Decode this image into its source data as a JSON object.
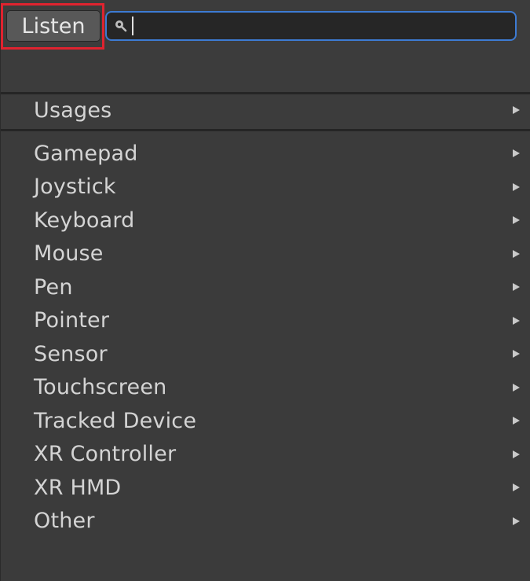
{
  "toolbar": {
    "listen_label": "Listen",
    "search_value": "",
    "search_placeholder": ""
  },
  "usages": {
    "label": "Usages"
  },
  "devices": [
    {
      "label": "Gamepad"
    },
    {
      "label": "Joystick"
    },
    {
      "label": "Keyboard"
    },
    {
      "label": "Mouse"
    },
    {
      "label": "Pen"
    },
    {
      "label": "Pointer"
    },
    {
      "label": "Sensor"
    },
    {
      "label": "Touchscreen"
    },
    {
      "label": "Tracked Device"
    },
    {
      "label": "XR Controller"
    },
    {
      "label": "XR HMD"
    },
    {
      "label": "Other"
    }
  ],
  "colors": {
    "highlight": "#e0232f",
    "search_focus": "#3d7bd3",
    "background": "#3b3b3b"
  },
  "icons": {
    "search": "search-icon",
    "submenu": "submenu-arrow-icon"
  }
}
